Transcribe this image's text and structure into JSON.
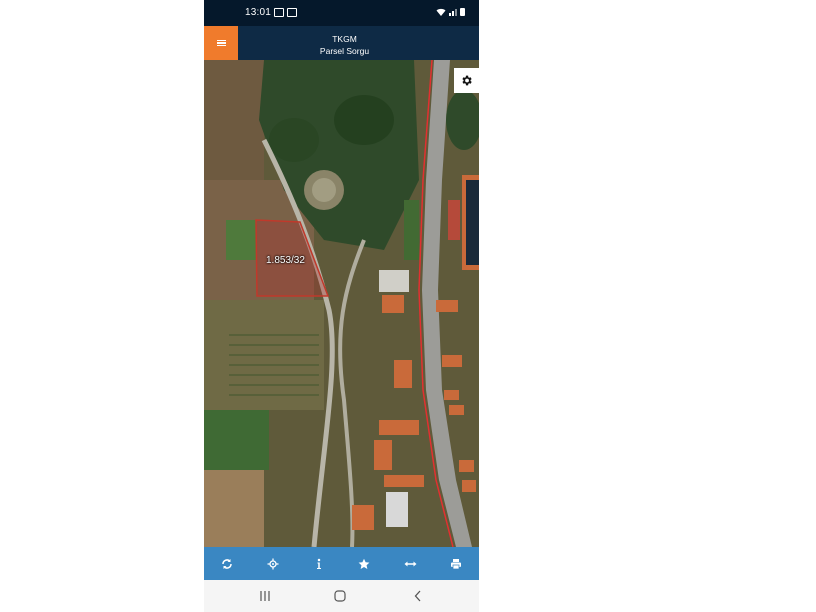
{
  "status_bar": {
    "time": "13:01"
  },
  "app_bar": {
    "title": "TKGM",
    "subtitle": "Parsel Sorgu"
  },
  "map": {
    "parcel_label": "1.853/32",
    "parcel_color": "#c0392b"
  },
  "toolbar": {
    "icons": [
      "refresh-icon",
      "locate-icon",
      "info-icon",
      "star-icon",
      "measure-icon",
      "print-icon"
    ]
  },
  "navigation_bar": {
    "icons": [
      "recent-apps-icon",
      "home-icon",
      "back-icon"
    ]
  },
  "colors": {
    "accent": "#f07b2c",
    "header": "#0e2a45",
    "toolbar": "#3a87c2"
  }
}
